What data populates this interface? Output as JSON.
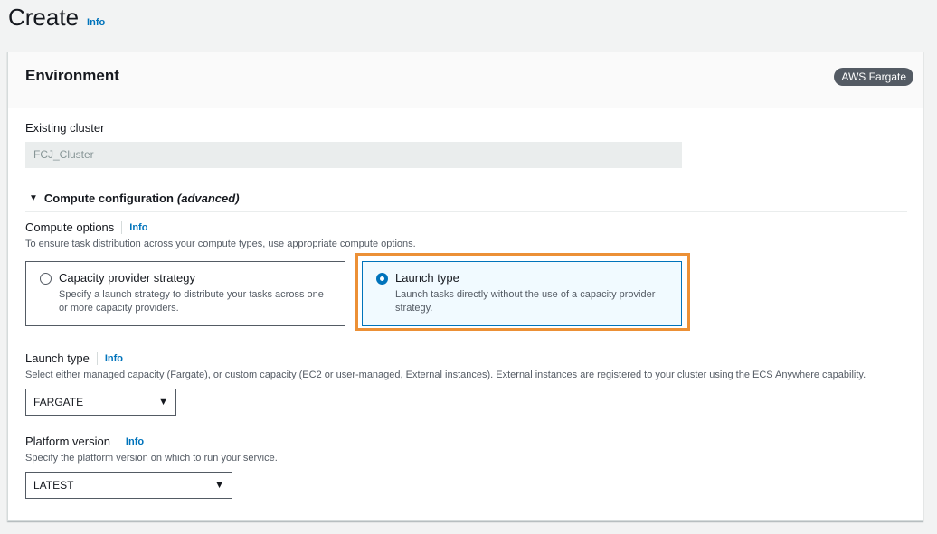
{
  "page": {
    "title": "Create",
    "info_label": "Info"
  },
  "environment": {
    "title": "Environment",
    "badge": "AWS Fargate",
    "existing_cluster": {
      "label": "Existing cluster",
      "value": "FCJ_Cluster"
    },
    "compute_configuration": {
      "label": "Compute configuration",
      "suffix": "(advanced)"
    },
    "compute_options": {
      "label": "Compute options",
      "info": "Info",
      "description": "To ensure task distribution across your compute types, use appropriate compute options.",
      "options": [
        {
          "title": "Capacity provider strategy",
          "description": "Specify a launch strategy to distribute your tasks across one or more capacity providers.",
          "selected": false
        },
        {
          "title": "Launch type",
          "description": "Launch tasks directly without the use of a capacity provider strategy.",
          "selected": true
        }
      ]
    },
    "launch_type": {
      "label": "Launch type",
      "info": "Info",
      "description": "Select either managed capacity (Fargate), or custom capacity (EC2 or user-managed, External instances). External instances are registered to your cluster using the ECS Anywhere capability.",
      "value": "FARGATE"
    },
    "platform_version": {
      "label": "Platform version",
      "info": "Info",
      "description": "Specify the platform version on which to run your service.",
      "value": "LATEST"
    }
  },
  "colors": {
    "accent": "#0073bb",
    "highlight": "#ec9036",
    "badge": "#545b64"
  }
}
